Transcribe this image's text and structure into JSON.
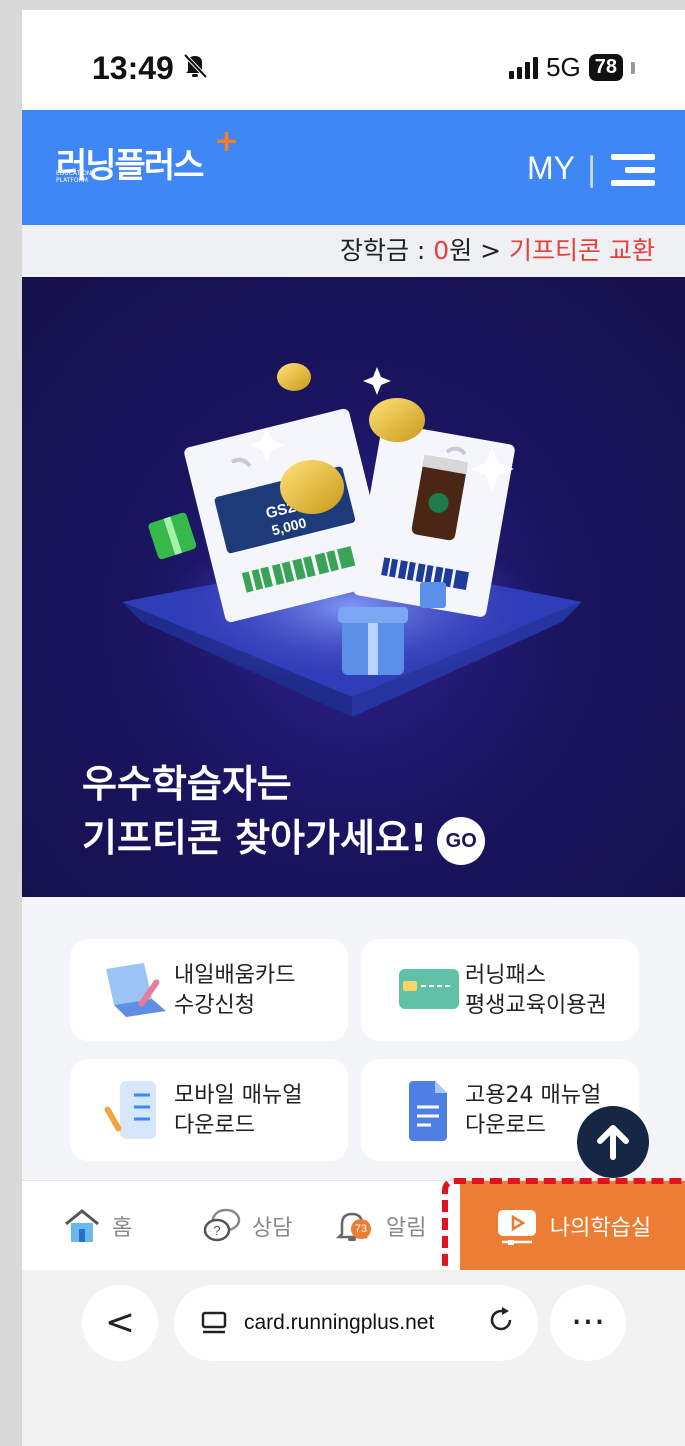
{
  "status_bar": {
    "time": "13:49",
    "network": "5G",
    "battery": "78"
  },
  "header": {
    "logo_text": "러닝플러스",
    "logo_plus": "+",
    "logo_sub": "EDUCATION PLATFORM",
    "my_label": "MY",
    "separator": "|"
  },
  "scholarship": {
    "prefix": "장학금 : ",
    "amount": "0",
    "unit": "원 > ",
    "link": "기프티콘 교환"
  },
  "banner": {
    "line1": "우수학습자는",
    "line2": "기프티콘 찾아가세요!",
    "go_label": "GO",
    "ticket_brand": "GS25",
    "ticket_amount": "5,000"
  },
  "cards": [
    {
      "line1": "내일배움카드",
      "line2": "수강신청",
      "icon": "laptop-pen-icon"
    },
    {
      "line1": "러닝패스",
      "line2": "평생교육이용권",
      "icon": "credit-card-icon"
    },
    {
      "line1": "모바일 매뉴얼",
      "line2": "다운로드",
      "icon": "checklist-phone-icon"
    },
    {
      "line1": "고용24 매뉴얼",
      "line2": "다운로드",
      "icon": "document-icon"
    }
  ],
  "tabbar": {
    "home": "홈",
    "consult": "상담",
    "alarm": "알림",
    "alarm_count": "73",
    "my_class": "나의학습실"
  },
  "browser": {
    "url": "card.runningplus.net",
    "back": "<",
    "more": "···"
  },
  "colors": {
    "header_blue": "#3e87f5",
    "accent_orange": "#ec7d35",
    "banner_navy": "#1a1460",
    "highlight_red": "#e0141e"
  }
}
